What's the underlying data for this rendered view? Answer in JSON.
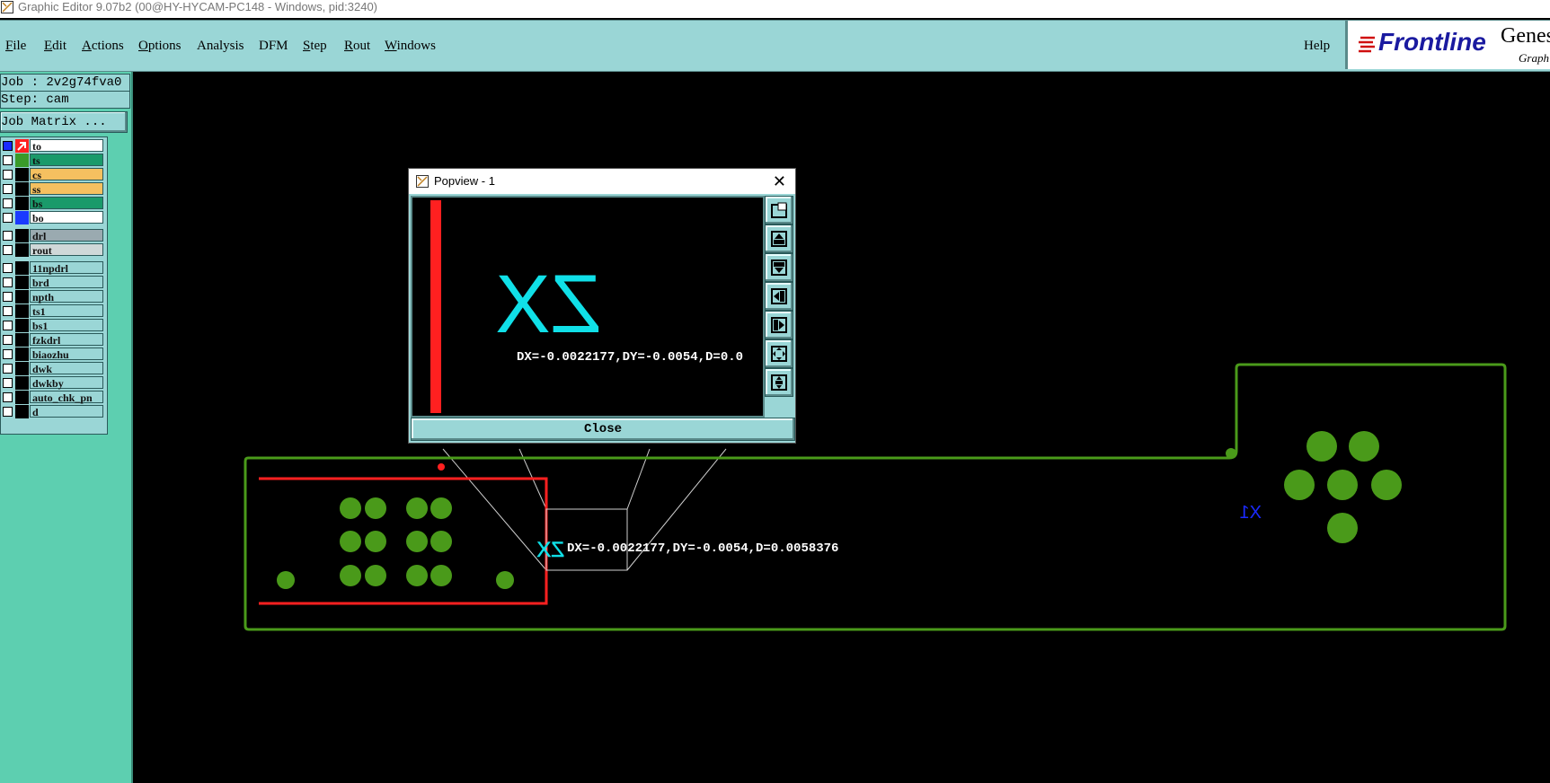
{
  "window": {
    "title": "Graphic Editor 9.07b2 (00@HY-HYCAM-PC148 - Windows, pid:3240)"
  },
  "menu": {
    "items": [
      {
        "label": "File",
        "u": "F",
        "rest": "ile"
      },
      {
        "label": "Edit",
        "u": "E",
        "rest": "dit"
      },
      {
        "label": "Actions",
        "u": "A",
        "rest": "ctions"
      },
      {
        "label": "Options",
        "u": "O",
        "rest": "ptions"
      },
      {
        "label": "Analysis",
        "u": "",
        "rest": "Analysis"
      },
      {
        "label": "DFM",
        "u": "",
        "rest": "DFM"
      },
      {
        "label": "Step",
        "u": "S",
        "rest": "tep"
      },
      {
        "label": "Rout",
        "u": "R",
        "rest": "out"
      },
      {
        "label": "Windows",
        "u": "W",
        "rest": "indows"
      }
    ],
    "help": "Help"
  },
  "brand": {
    "logo": "Frontline",
    "product": "Genes",
    "sub": "Graph"
  },
  "sidebar": {
    "job": "Job : 2v2g74fva0",
    "step": "Step: cam",
    "job_matrix": "Job Matrix ...",
    "layers": [
      {
        "name": "to",
        "swatch": "#ff2020",
        "bg": "#ffffff",
        "checked": true,
        "active": true
      },
      {
        "name": "ts",
        "swatch": "#3a9a2a",
        "bg": "#1a9a6a",
        "checked": false
      },
      {
        "name": "cs",
        "swatch": "#000000",
        "bg": "#f5c060",
        "checked": false
      },
      {
        "name": "ss",
        "swatch": "#000000",
        "bg": "#f5c060",
        "checked": false
      },
      {
        "name": "bs",
        "swatch": "#000000",
        "bg": "#1a9a6a",
        "checked": false
      },
      {
        "name": "bo",
        "swatch": "#1a3aff",
        "bg": "#ffffff",
        "checked": false
      },
      {
        "name": "drl",
        "swatch": "#000000",
        "bg": "#9aaab0",
        "checked": false,
        "group_gap": true
      },
      {
        "name": "rout",
        "swatch": "#000000",
        "bg": "#cfd8d8",
        "checked": false
      },
      {
        "name": "11npdrl",
        "swatch": "#000000",
        "bg": "#9ad6d6",
        "checked": false,
        "group_gap": true
      },
      {
        "name": "brd",
        "swatch": "#000000",
        "bg": "#9ad6d6",
        "checked": false
      },
      {
        "name": "npth",
        "swatch": "#000000",
        "bg": "#9ad6d6",
        "checked": false
      },
      {
        "name": "ts1",
        "swatch": "#000000",
        "bg": "#9ad6d6",
        "checked": false
      },
      {
        "name": "bs1",
        "swatch": "#000000",
        "bg": "#9ad6d6",
        "checked": false
      },
      {
        "name": "fzkdrl",
        "swatch": "#000000",
        "bg": "#9ad6d6",
        "checked": false
      },
      {
        "name": "biaozhu",
        "swatch": "#000000",
        "bg": "#9ad6d6",
        "checked": false
      },
      {
        "name": "dwk",
        "swatch": "#000000",
        "bg": "#9ad6d6",
        "checked": false
      },
      {
        "name": "dwkby",
        "swatch": "#000000",
        "bg": "#9ad6d6",
        "checked": false
      },
      {
        "name": "auto_chk_pn",
        "swatch": "#000000",
        "bg": "#9ad6d6",
        "checked": false
      },
      {
        "name": "d",
        "swatch": "#000000",
        "bg": "#9ad6d6",
        "checked": false
      }
    ]
  },
  "popview": {
    "title": "Popview - 1",
    "close_glyph": "✕",
    "measure": "DX=-0.0022177,DY=-0.0054,D=0.0",
    "close_button": "Close",
    "tools": [
      "zoom-window-icon",
      "pan-up-icon",
      "pan-down-icon",
      "pan-left-icon",
      "pan-right-icon",
      "zoom-fit-icon",
      "zoom-home-icon"
    ]
  },
  "canvas": {
    "measure": "DX=-0.0022177,DY=-0.0054,D=0.0058376",
    "marker_left": "ZX",
    "marker_right": "X1",
    "colors": {
      "outline": "#4a9a1a",
      "pad": "#4a9a1a",
      "frame": "#ff2020",
      "text_cyan": "#10e0e8",
      "text_blue": "#1a2aff"
    }
  }
}
